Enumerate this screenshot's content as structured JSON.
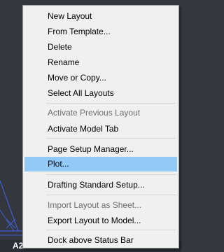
{
  "layout_tab": {
    "label": "A2"
  },
  "context_menu": {
    "items": [
      {
        "label": "New Layout",
        "disabled": false,
        "highlighted": false
      },
      {
        "label": "From Template...",
        "disabled": false,
        "highlighted": false
      },
      {
        "label": "Delete",
        "disabled": false,
        "highlighted": false
      },
      {
        "label": "Rename",
        "disabled": false,
        "highlighted": false
      },
      {
        "label": "Move or Copy...",
        "disabled": false,
        "highlighted": false
      },
      {
        "label": "Select All Layouts",
        "disabled": false,
        "highlighted": false
      },
      {
        "label": "Activate Previous Layout",
        "disabled": true,
        "highlighted": false
      },
      {
        "label": "Activate Model Tab",
        "disabled": false,
        "highlighted": false
      },
      {
        "label": "Page Setup Manager...",
        "disabled": false,
        "highlighted": false
      },
      {
        "label": "Plot...",
        "disabled": false,
        "highlighted": true
      },
      {
        "label": "Drafting Standard Setup...",
        "disabled": false,
        "highlighted": false
      },
      {
        "label": "Import Layout as Sheet...",
        "disabled": true,
        "highlighted": false
      },
      {
        "label": "Export Layout to Model...",
        "disabled": false,
        "highlighted": false
      },
      {
        "label": "Dock above Status Bar",
        "disabled": false,
        "highlighted": false
      }
    ]
  },
  "colors": {
    "menu_background": "#f0f0f0",
    "highlight": "#91c9f7",
    "canvas": "#34373e",
    "drawing_lines": "#3f5fd6"
  }
}
